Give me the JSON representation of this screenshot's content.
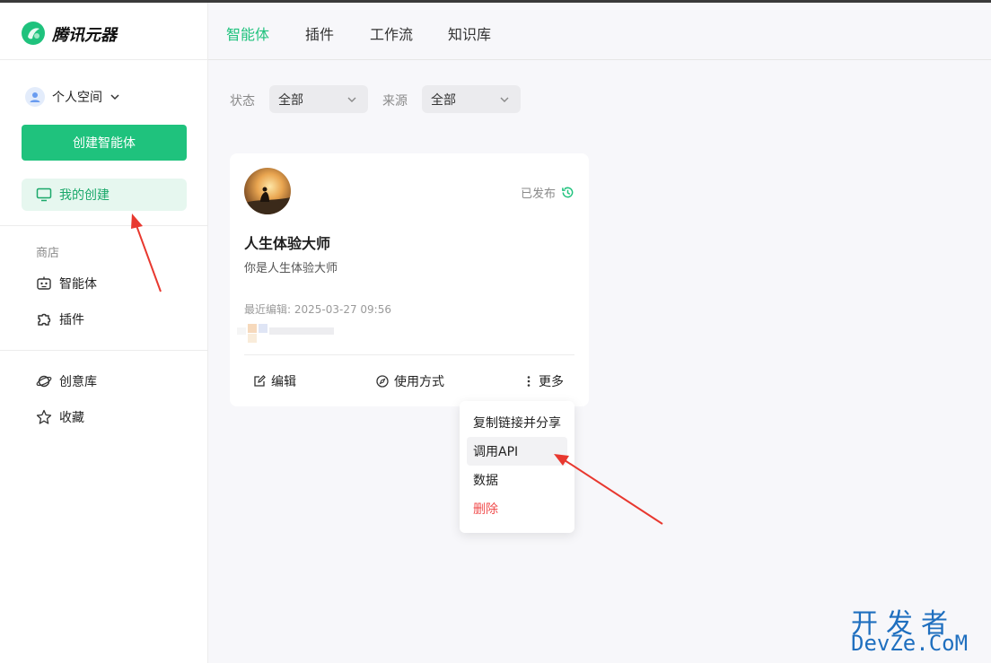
{
  "app": {
    "name": "腾讯元器"
  },
  "colors": {
    "brand": "#1fc27d",
    "danger": "#f04c4c",
    "annotation_arrow": "#e8382f"
  },
  "header": {
    "tabs": [
      {
        "label": "智能体",
        "active": true
      },
      {
        "label": "插件",
        "active": false
      },
      {
        "label": "工作流",
        "active": false
      },
      {
        "label": "知识库",
        "active": false
      }
    ]
  },
  "sidebar": {
    "space_label": "个人空间",
    "create_button": "创建智能体",
    "my_create": "我的创建",
    "store_label": "商店",
    "store_items": [
      {
        "label": "智能体",
        "icon": "robot-icon"
      },
      {
        "label": "插件",
        "icon": "puzzle-icon"
      }
    ],
    "other_items": [
      {
        "label": "创意库",
        "icon": "planet-icon"
      },
      {
        "label": "收藏",
        "icon": "star-icon"
      }
    ]
  },
  "filters": [
    {
      "label": "状态",
      "value": "全部"
    },
    {
      "label": "来源",
      "value": "全部"
    }
  ],
  "card": {
    "name": "人生体验大师",
    "description": "你是人生体验大师",
    "status": "已发布",
    "last_edit": "最近编辑: 2025-03-27 09:56",
    "actions": [
      {
        "label": "编辑",
        "icon": "edit-icon"
      },
      {
        "label": "使用方式",
        "icon": "compass-icon"
      },
      {
        "label": "更多",
        "icon": "more-vertical-icon"
      }
    ]
  },
  "more_menu": [
    {
      "label": "复制链接并分享"
    },
    {
      "label": "调用API",
      "hovered": true
    },
    {
      "label": "数据"
    },
    {
      "label": "删除",
      "danger": true
    }
  ],
  "watermark": {
    "cn": "开发者",
    "en": "DevZe.CoM"
  }
}
